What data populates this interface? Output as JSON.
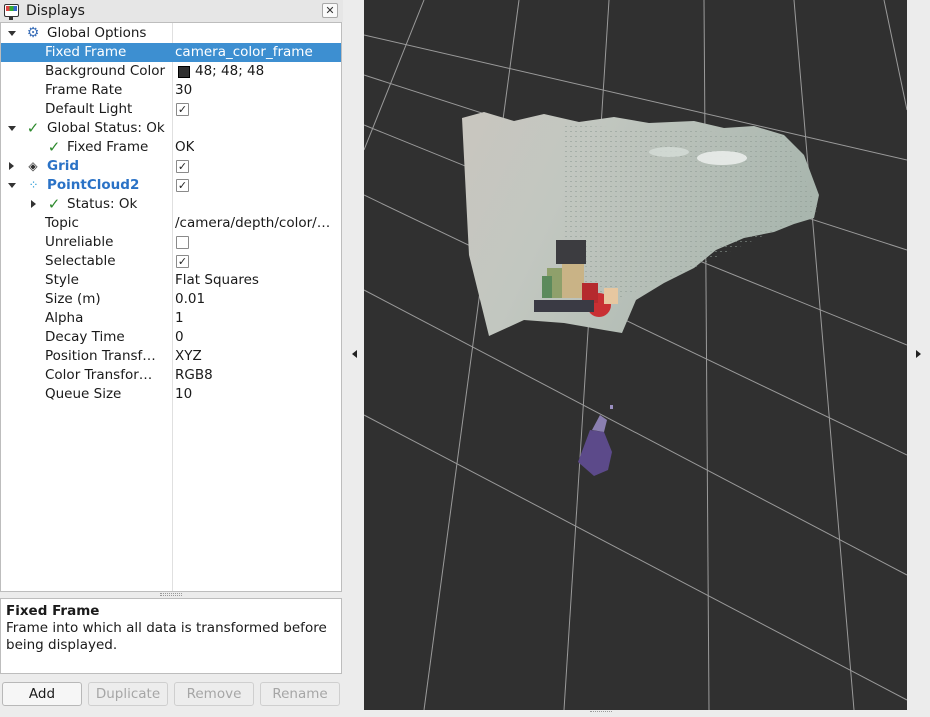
{
  "panel": {
    "title": "Displays",
    "close_glyph": "✕"
  },
  "tree": [
    {
      "label": "Global Options",
      "value": "",
      "icon": "gear-icon",
      "expander": "open",
      "indent": 0
    },
    {
      "label": "Fixed Frame",
      "value": "camera_color_frame",
      "selected": true,
      "indent": 1
    },
    {
      "label": "Background Color",
      "value": "48; 48; 48",
      "swatch": "#303030",
      "indent": 1
    },
    {
      "label": "Frame Rate",
      "value": "30",
      "indent": 1
    },
    {
      "label": "Default Light",
      "checked": true,
      "indent": 1
    },
    {
      "label": "Global Status: Ok",
      "value": "",
      "icon": "check-icon",
      "expander": "open",
      "indent": 0
    },
    {
      "label": "Fixed Frame",
      "value": "OK",
      "icon": "check-icon",
      "indent": 1
    },
    {
      "label": "Grid",
      "checked": true,
      "icon": "grid-icon",
      "expander": "closed",
      "blue": true,
      "indent": 0
    },
    {
      "label": "PointCloud2",
      "checked": true,
      "icon": "pointcloud-icon",
      "expander": "open",
      "blue": true,
      "indent": 0
    },
    {
      "label": "Status: Ok",
      "value": "",
      "icon": "check-icon",
      "expander": "closed",
      "indent": 1
    },
    {
      "label": "Topic",
      "value": "/camera/depth/color/…",
      "indent": 1
    },
    {
      "label": "Unreliable",
      "checked": false,
      "indent": 1
    },
    {
      "label": "Selectable",
      "checked": true,
      "indent": 1
    },
    {
      "label": "Style",
      "value": "Flat Squares",
      "indent": 1
    },
    {
      "label": "Size (m)",
      "value": "0.01",
      "indent": 1
    },
    {
      "label": "Alpha",
      "value": "1",
      "indent": 1
    },
    {
      "label": "Decay Time",
      "value": "0",
      "indent": 1
    },
    {
      "label": "Position Transf…",
      "value": "XYZ",
      "indent": 1
    },
    {
      "label": "Color Transfor…",
      "value": "RGB8",
      "indent": 1
    },
    {
      "label": "Queue Size",
      "value": "10",
      "indent": 1
    }
  ],
  "description": {
    "title": "Fixed Frame",
    "text": "Frame into which all data is transformed before being displayed."
  },
  "buttons": {
    "add": "Add",
    "duplicate": "Duplicate",
    "remove": "Remove",
    "rename": "Rename"
  },
  "view": {
    "background": "#303030",
    "grid_color": "#a0a0a0"
  }
}
